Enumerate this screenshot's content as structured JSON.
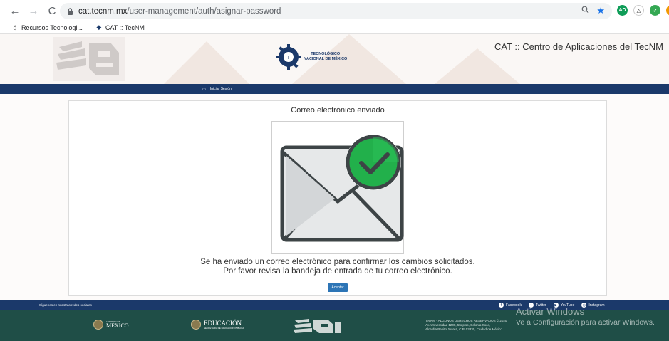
{
  "browser": {
    "url_host": "cat.tecnm.mx",
    "url_path": "/user-management/auth/asignar-password",
    "bookmarks": [
      {
        "label": "Recursos Tecnologi..."
      },
      {
        "label": "CAT :: TecNM"
      }
    ],
    "extensions": [
      {
        "label": "AD",
        "color": "#0f9d58"
      },
      {
        "label": "",
        "color": "#34a853"
      },
      {
        "label": "",
        "color": "#f29900"
      }
    ]
  },
  "header": {
    "logo_line1": "TECNOLÓGICO",
    "logo_line2": "NACIONAL DE MÉXICO",
    "site_title": "CAT :: Centro de Aplicaciones del TecNM"
  },
  "nav": {
    "home_label": "Iniciar Sesión"
  },
  "card": {
    "title": "Correo electrónico enviado",
    "message_line1": "Se ha enviado un correo electrónico para confirmar los cambios solicitados.",
    "message_line2": "Por favor revisa la bandeja de entrada de tu correo electrónico.",
    "accept_label": "Aceptar"
  },
  "footer": {
    "follow_text": "Síguenos en nuestras redes sociales",
    "social": [
      {
        "label": "Facebook",
        "icon": "f"
      },
      {
        "label": "Twitter",
        "icon": "t"
      },
      {
        "label": "YouTube",
        "icon": "▶"
      },
      {
        "label": "Instagram",
        "icon": "◎"
      }
    ],
    "gob_small": "GOBIERNO DE",
    "gob_main": "MÉXICO",
    "edu_main": "EDUCACIÓN",
    "edu_small": "SECRETARÍA DE EDUCACIÓN PÚBLICA",
    "address_line1": "TecNM - ALGUNOS DERECHOS RESERVADOS © 2020",
    "address_line2": "Av. Universidad 1200, 5to piso, Colonia Xoco,",
    "address_line3": "Alcaldía Benito Juárez, C.P. 03330, Ciudad de México"
  },
  "watermark": {
    "title": "Activar Windows",
    "subtitle": "Ve a Configuración para activar Windows."
  }
}
